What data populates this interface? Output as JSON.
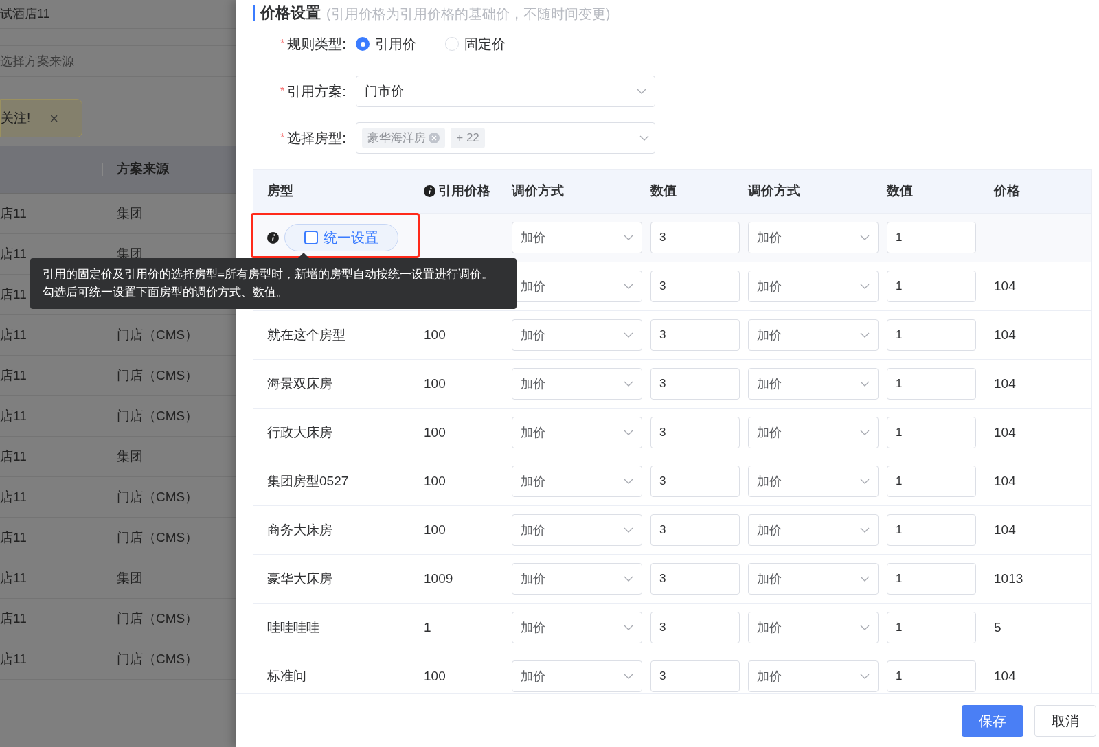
{
  "background": {
    "hotel": "试酒店11",
    "source_placeholder": "选择方案来源",
    "alert": {
      "text": "关注!",
      "close": "×"
    },
    "table": {
      "columns": [
        "方案来源"
      ],
      "rows": [
        {
          "hotel": "店11",
          "source": "集团"
        },
        {
          "hotel": "店11",
          "source": "集团"
        },
        {
          "hotel": "店11"
        },
        {
          "hotel": "店11",
          "source": "门店（CMS）"
        },
        {
          "hotel": "店11",
          "source": "门店（CMS）"
        },
        {
          "hotel": "店11",
          "source": "门店（CMS）"
        },
        {
          "hotel": "店11",
          "source": "集团"
        },
        {
          "hotel": "店11",
          "source": "门店（CMS）"
        },
        {
          "hotel": "店11",
          "source": "门店（CMS）"
        },
        {
          "hotel": "店11",
          "source": "集团"
        },
        {
          "hotel": "店11",
          "source": "门店（CMS）"
        },
        {
          "hotel": "店11",
          "source": "门店（CMS）"
        }
      ]
    }
  },
  "section": {
    "title": "价格设置",
    "subtitle": "(引用价格为引用价格的基础价，不随时间变更)"
  },
  "form": {
    "required_mark": "*",
    "rule_type": {
      "label": "规则类型:",
      "options": [
        {
          "label": "引用价",
          "selected": true
        },
        {
          "label": "固定价",
          "selected": false
        }
      ]
    },
    "scheme": {
      "label": "引用方案:",
      "value": "门市价"
    },
    "room_types": {
      "label": "选择房型:",
      "tags": [
        "豪华海洋房"
      ],
      "more": "+ 22"
    }
  },
  "table": {
    "columns": [
      "房型",
      "引用价格",
      "调价方式",
      "数值",
      "调价方式",
      "数值",
      "价格"
    ],
    "unified": {
      "label": "统一设置",
      "checked": false,
      "method1": "加价",
      "value1": "3",
      "method2": "加价",
      "value2": "1"
    },
    "rows": [
      {
        "method1": "加价",
        "value1": "3",
        "method2": "加价",
        "value2": "1",
        "price": "104"
      },
      {
        "room": "就在这个房型",
        "ref": "100",
        "method1": "加价",
        "value1": "3",
        "method2": "加价",
        "value2": "1",
        "price": "104"
      },
      {
        "room": "海景双床房",
        "ref": "100",
        "method1": "加价",
        "value1": "3",
        "method2": "加价",
        "value2": "1",
        "price": "104"
      },
      {
        "room": "行政大床房",
        "ref": "100",
        "method1": "加价",
        "value1": "3",
        "method2": "加价",
        "value2": "1",
        "price": "104"
      },
      {
        "room": "集团房型0527",
        "ref": "100",
        "method1": "加价",
        "value1": "3",
        "method2": "加价",
        "value2": "1",
        "price": "104"
      },
      {
        "room": "商务大床房",
        "ref": "100",
        "method1": "加价",
        "value1": "3",
        "method2": "加价",
        "value2": "1",
        "price": "104"
      },
      {
        "room": "豪华大床房",
        "ref": "1009",
        "method1": "加价",
        "value1": "3",
        "method2": "加价",
        "value2": "1",
        "price": "1013"
      },
      {
        "room": "哇哇哇哇",
        "ref": "1",
        "method1": "加价",
        "value1": "3",
        "method2": "加价",
        "value2": "1",
        "price": "5"
      },
      {
        "room": "标准间",
        "ref": "100",
        "method1": "加价",
        "value1": "3",
        "method2": "加价",
        "value2": "1",
        "price": "104"
      }
    ]
  },
  "tooltip": {
    "lines": [
      "引用的固定价及引用价的选择房型=所有房型时，新增的房型自动按统一设置进行调价。",
      "勾选后可统一设置下面房型的调价方式、数值。"
    ]
  },
  "buttons": [
    {
      "label": "保存",
      "kind": "primary"
    },
    {
      "label": "取消",
      "kind": "default"
    }
  ]
}
